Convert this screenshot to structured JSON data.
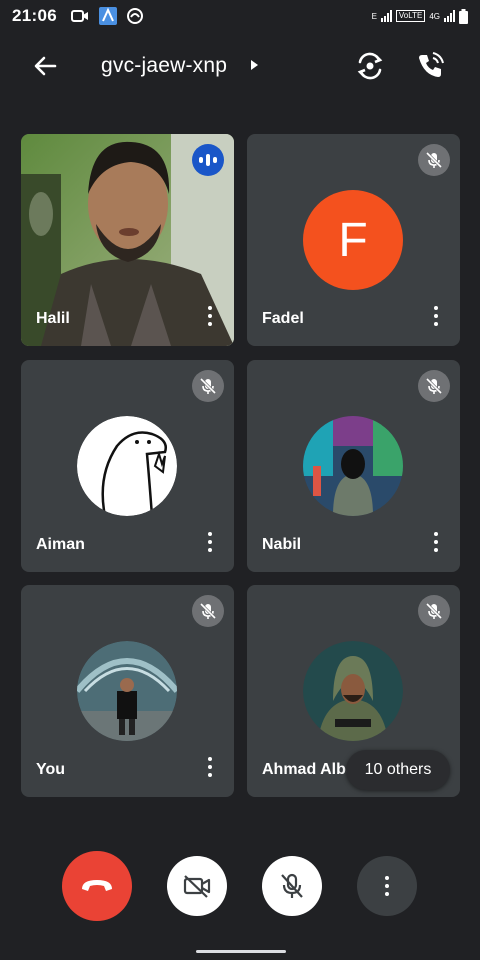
{
  "status_bar": {
    "time": "21:06",
    "network_label": "VoLTE",
    "network_type": "4G",
    "sim_label": "E"
  },
  "header": {
    "meeting_code": "gvc-jaew-xnp"
  },
  "participants": [
    {
      "name": "Halil",
      "state": "speaking",
      "media": "video"
    },
    {
      "name": "Fadel",
      "state": "muted",
      "media": "letter",
      "initial": "F"
    },
    {
      "name": "Aiman",
      "state": "muted",
      "media": "photo"
    },
    {
      "name": "Nabil",
      "state": "muted",
      "media": "photo"
    },
    {
      "name": "You",
      "state": "muted",
      "media": "photo"
    },
    {
      "name": "Ahmad Alba",
      "state": "muted",
      "media": "photo"
    }
  ],
  "others_pill": {
    "label": "10 others"
  },
  "colors": {
    "background": "#202124",
    "tile": "#3c4043",
    "end_call": "#ea4335",
    "letter_avatar": "#f4511e",
    "speaking_badge": "#1a56c8"
  },
  "icons": {
    "back": "arrow-left-icon",
    "switch_camera": "switch-camera-icon",
    "audio_output": "phone-speaker-icon",
    "muted": "mic-off-icon",
    "end_call": "phone-hangup-icon",
    "camera_off": "videocam-off-icon",
    "mic_off": "mic-off-icon",
    "more": "more-vert-icon"
  }
}
